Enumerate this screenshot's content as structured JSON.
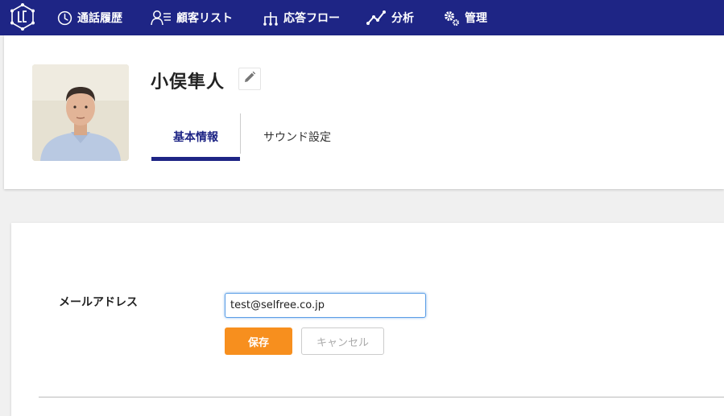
{
  "nav": {
    "logo_icon": "brand-logo-icon",
    "items": [
      {
        "label": "通話履歴",
        "icon": "clock-icon"
      },
      {
        "label": "顧客リスト",
        "icon": "customer-list-icon"
      },
      {
        "label": "応答フロー",
        "icon": "flow-icon"
      },
      {
        "label": "分析",
        "icon": "chart-line-icon"
      },
      {
        "label": "管理",
        "icon": "gears-icon"
      }
    ]
  },
  "profile": {
    "name": "小俣隼人",
    "edit_icon": "pencil-icon",
    "tabs": [
      {
        "label": "基本情報",
        "active": true
      },
      {
        "label": "サウンド設定",
        "active": false
      }
    ]
  },
  "form": {
    "email_label": "メールアドレス",
    "email_value": "test@selfree.co.jp",
    "save_label": "保存",
    "cancel_label": "キャンセル"
  },
  "colors": {
    "nav_bg": "#1e2585",
    "accent": "#1e2585",
    "save_button": "#f78f1e"
  }
}
